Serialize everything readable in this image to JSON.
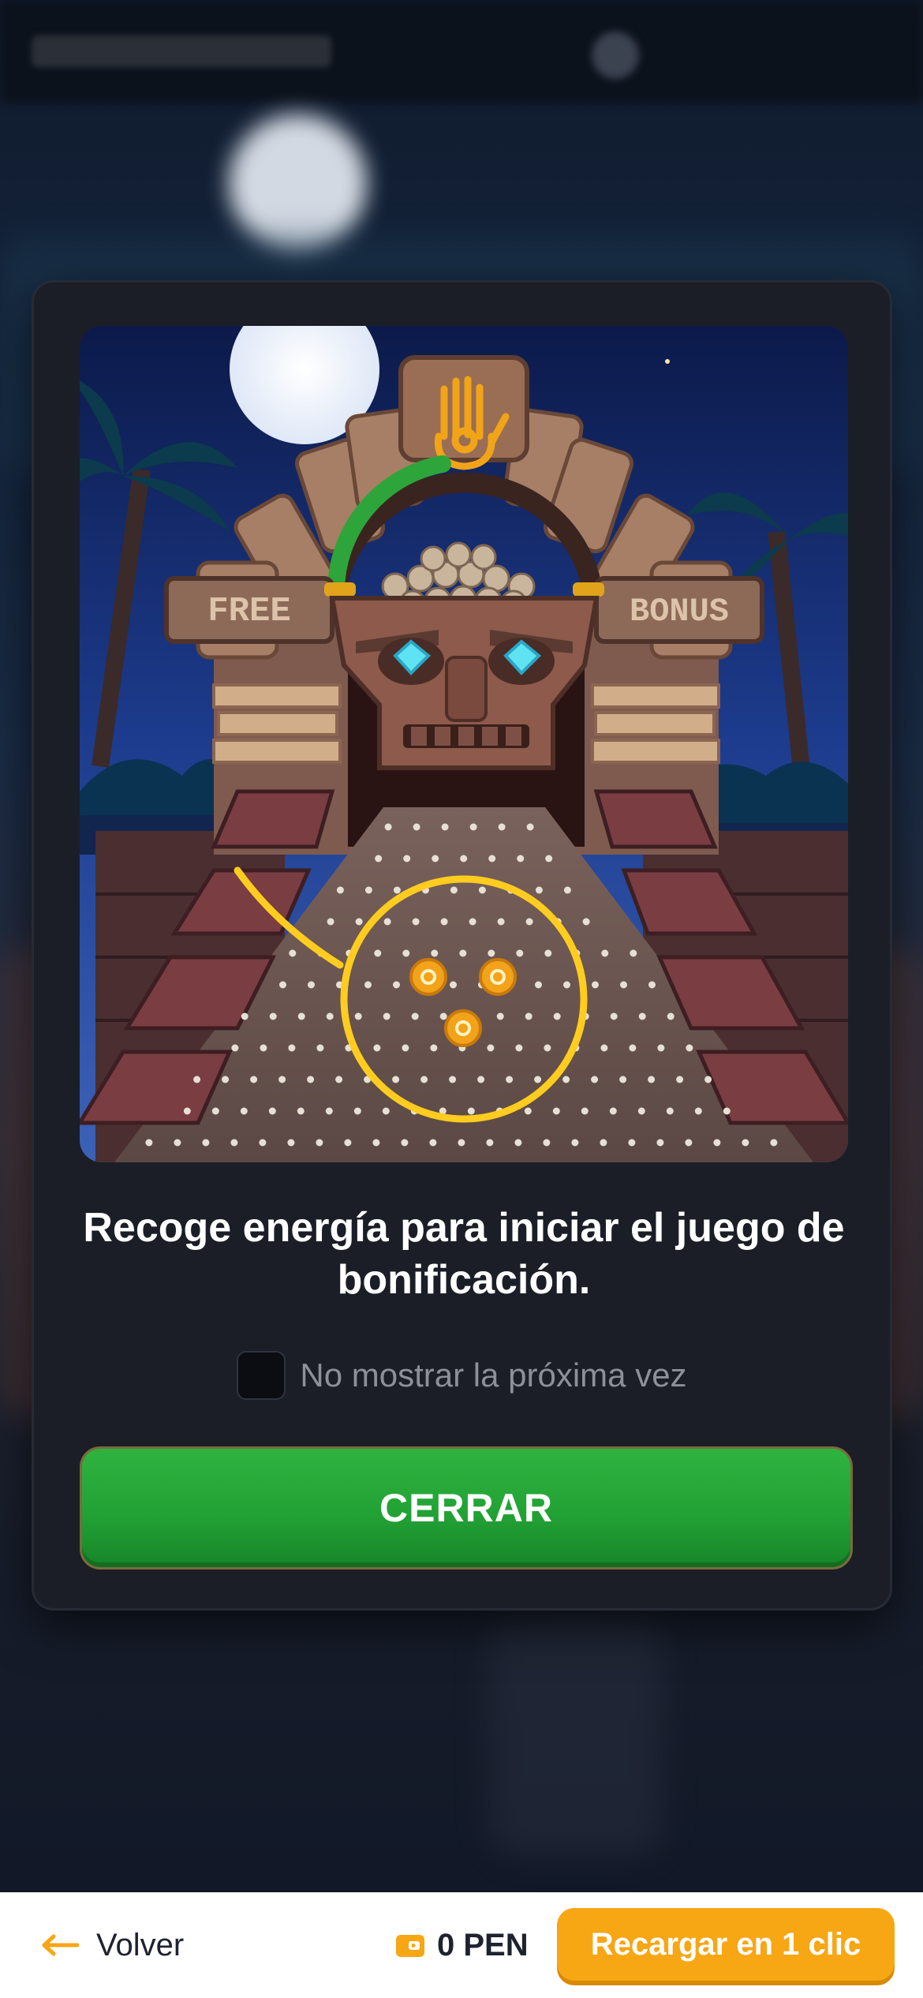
{
  "modal": {
    "description": "Recoge energía para iniciar el juego de bonificación.",
    "checkbox_label": "No mostrar la próxima vez",
    "checkbox_checked": false,
    "close_label": "CERRAR",
    "art": {
      "left_sign": "FREE",
      "right_sign": "BONUS",
      "energy_progress": 0.25
    }
  },
  "bottom_bar": {
    "back_label": "Volver",
    "balance": "0 PEN",
    "recharge_label": "Recargar en 1 clic"
  },
  "colors": {
    "accent_orange": "#f7a614",
    "button_green": "#22a235",
    "highlight_yellow": "#ffcc1f",
    "modal_bg": "#1b1e26"
  },
  "icons": [
    "back-arrow-icon",
    "wallet-icon",
    "hand-spiral-icon"
  ]
}
